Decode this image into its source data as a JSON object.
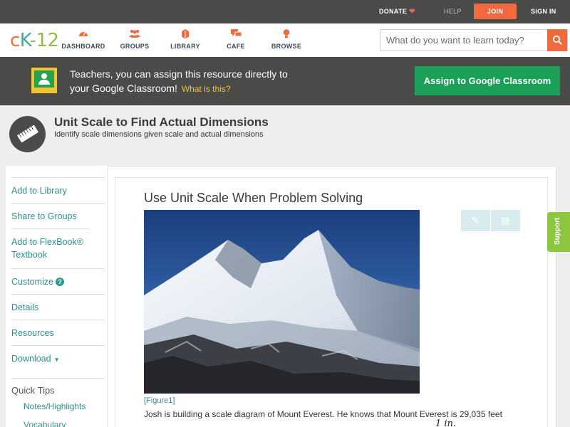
{
  "topbar": {
    "donate": "DONATE",
    "help": "HELP",
    "join": "JOIN",
    "sign_in": "SIGN IN"
  },
  "brand": {
    "logo_c": "c",
    "logo_k": "K",
    "logo_n": "-12",
    "accent": "#ef6a3c",
    "teal": "#4aa7a0",
    "green": "#8dbe4a"
  },
  "nav": {
    "items": [
      {
        "label": "DASHBOARD",
        "icon": "dashboard-icon"
      },
      {
        "label": "GROUPS",
        "icon": "groups-icon"
      },
      {
        "label": "LIBRARY",
        "icon": "library-icon"
      },
      {
        "label": "CAFE",
        "icon": "cafe-icon"
      },
      {
        "label": "BROWSE",
        "icon": "browse-icon"
      }
    ]
  },
  "search": {
    "placeholder": "What do you want to learn today?",
    "value": ""
  },
  "banner": {
    "line1": "Teachers, you can assign this resource directly to",
    "line2": "your Google Classroom!",
    "what_is_this": "What is this?",
    "assign_button": "Assign to Google Classroom"
  },
  "concept": {
    "title": "Unit Scale to Find Actual Dimensions",
    "subtitle": "Identify scale dimensions given scale and actual dimensions"
  },
  "sidebar": {
    "items": [
      {
        "label": "Add to Library"
      },
      {
        "label": "Share to Groups"
      },
      {
        "label": "Add to FlexBook® Textbook"
      },
      {
        "label": "Customize"
      },
      {
        "label": "Details"
      },
      {
        "label": "Resources"
      },
      {
        "label": "Download"
      }
    ],
    "quick_tips": "Quick Tips",
    "sub_items": [
      {
        "label": "Notes/Highlights"
      },
      {
        "label": "Vocabulary"
      }
    ]
  },
  "lesson": {
    "title": "Use Unit Scale When Problem Solving",
    "figure_label": "[Figure1]",
    "paragraph": "Josh is building a scale diagram of Mount Everest. He knows that Mount Everest is 29,035 feet",
    "math_fragment": "1 in."
  },
  "support": {
    "label": "Support"
  }
}
